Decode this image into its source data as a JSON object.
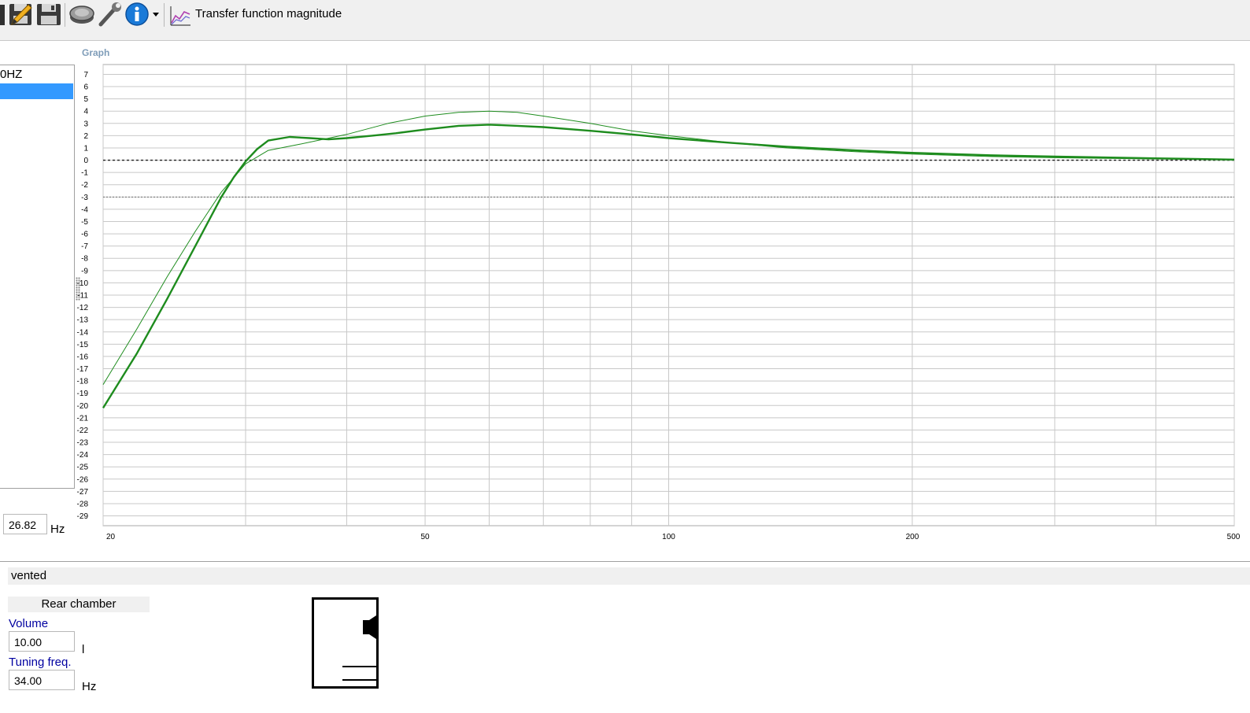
{
  "toolbar": {
    "title": "Transfer function magnitude",
    "icons": [
      "project-icon",
      "edit-icon",
      "save-icon",
      "driver-icon",
      "tools-icon",
      "info-icon",
      "dropdown-arrow-icon",
      "chart-icon"
    ]
  },
  "graph": {
    "label": "Graph"
  },
  "list": {
    "items": [
      "0HZ",
      ""
    ],
    "selected_index": 1
  },
  "freq_readout": {
    "value": "26.82",
    "unit": "Hz"
  },
  "bottom": {
    "box_type": "vented",
    "rear_chamber": "Rear chamber",
    "volume_label": "Volume",
    "volume_value": "10.00",
    "volume_unit": "l",
    "tuning_label": "Tuning freq.",
    "tuning_value": "34.00",
    "tuning_unit": "Hz"
  },
  "colors": {
    "curve": "#1e8c1e",
    "selection": "#3399ff",
    "grid": "#c8c8c8",
    "label": "#7f9db9"
  },
  "chart_data": {
    "type": "line",
    "xlabel": "",
    "ylabel": "",
    "x_scale": "log",
    "xlim": [
      20,
      500
    ],
    "ylim": [
      -29.8,
      7.8
    ],
    "x_ticks": [
      20,
      50,
      100,
      200,
      500
    ],
    "y_ticks": [
      7,
      6,
      5,
      4,
      3,
      2,
      1,
      0,
      -1,
      -2,
      -3,
      -4,
      -5,
      -6,
      -7,
      -8,
      -9,
      -10,
      -11,
      -12,
      -13,
      -14,
      -15,
      -16,
      -17,
      -18,
      -19,
      -20,
      -21,
      -22,
      -23,
      -24,
      -25,
      -26,
      -27,
      -28,
      -29
    ],
    "reference_lines": [
      0,
      -3
    ],
    "grid": true,
    "series": [
      {
        "x": [
          20,
          22,
          24,
          26,
          28,
          29,
          30,
          31,
          32,
          34,
          36,
          38,
          40,
          43,
          46,
          50,
          55,
          60,
          65,
          70,
          80,
          90,
          100,
          120,
          140,
          170,
          200,
          250,
          300,
          400,
          500
        ],
        "y": [
          -20.2,
          -15.8,
          -11.3,
          -7.0,
          -3.0,
          -1.4,
          -0.1,
          0.9,
          1.6,
          1.9,
          1.8,
          1.7,
          1.8,
          2.0,
          2.2,
          2.5,
          2.8,
          2.9,
          2.8,
          2.7,
          2.4,
          2.1,
          1.8,
          1.4,
          1.1,
          0.8,
          0.6,
          0.4,
          0.3,
          0.15,
          0.05
        ]
      },
      {
        "x": [
          20,
          22,
          24,
          26,
          28,
          30,
          32,
          35,
          40,
          45,
          50,
          55,
          60,
          65,
          70,
          80,
          90,
          100,
          120,
          140,
          170,
          200,
          250,
          300,
          400,
          500
        ],
        "y": [
          -18.3,
          -13.8,
          -9.5,
          -5.8,
          -2.6,
          -0.3,
          0.8,
          1.3,
          2.1,
          3.0,
          3.6,
          3.9,
          4.0,
          3.9,
          3.6,
          3.0,
          2.4,
          2.0,
          1.4,
          1.0,
          0.7,
          0.5,
          0.3,
          0.2,
          0.1,
          0.05
        ]
      }
    ]
  }
}
